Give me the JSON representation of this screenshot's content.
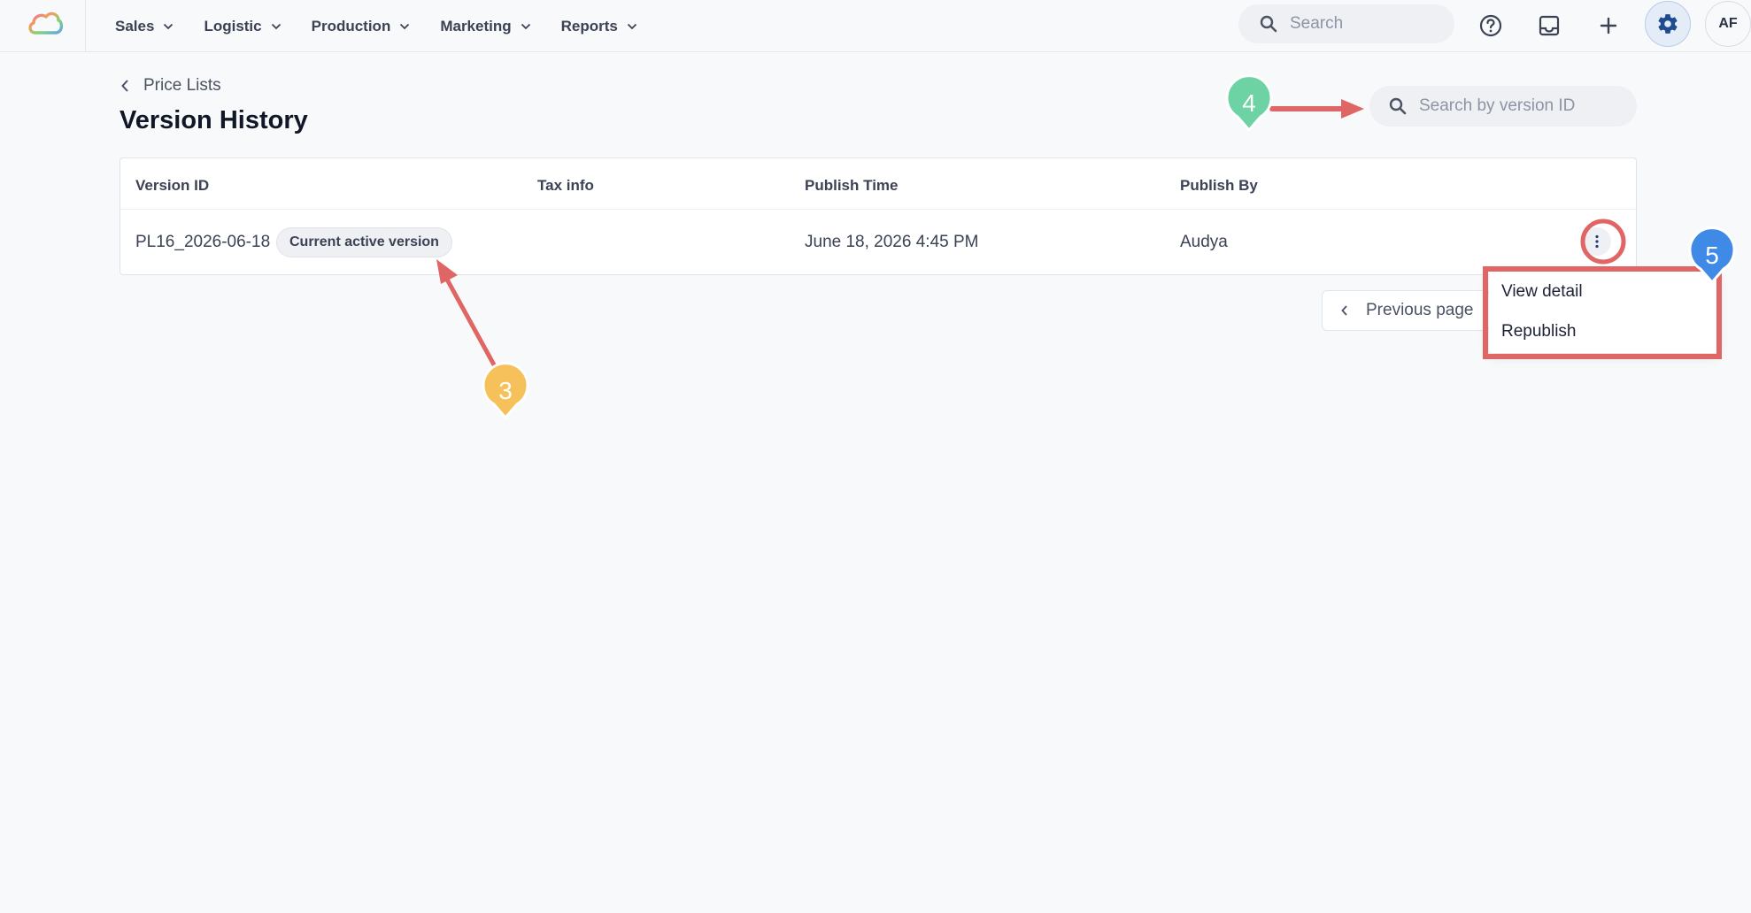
{
  "nav": {
    "items": [
      {
        "label": "Sales"
      },
      {
        "label": "Logistic"
      },
      {
        "label": "Production"
      },
      {
        "label": "Marketing"
      },
      {
        "label": "Reports"
      }
    ],
    "search_placeholder": "Search",
    "avatar_initials": "AF"
  },
  "page": {
    "breadcrumb": "Price Lists",
    "title": "Version History",
    "search_placeholder": "Search by version ID"
  },
  "table": {
    "columns": [
      "Version ID",
      "Tax info",
      "Publish Time",
      "Publish By"
    ],
    "rows": [
      {
        "version_id": "PL16_2026-06-18",
        "badge": "Current active version",
        "tax_info": "",
        "publish_time": "June 18, 2026 4:45 PM",
        "publish_by": "Audya"
      }
    ]
  },
  "pagination": {
    "prev_label": "Previous page"
  },
  "row_menu": {
    "items": [
      "View detail",
      "Republish"
    ]
  },
  "annotations": {
    "markers": [
      "3",
      "4",
      "5"
    ],
    "colors": {
      "arrow": "#e06666",
      "marker_3": "#f6c15a",
      "marker_4": "#6ed3a4",
      "marker_5": "#3f8ae6"
    }
  },
  "colors": {
    "background": "#f8f9fb",
    "surface": "#ffffff",
    "text_primary": "#101828",
    "text_secondary": "#3a4254",
    "accent": "#1f4b8f"
  },
  "icons": [
    "logo-cloud-icon",
    "chevron-down-icon",
    "search-icon",
    "help-icon",
    "inbox-icon",
    "plus-icon",
    "gear-icon",
    "chevron-left-icon",
    "more-vertical-icon"
  ]
}
